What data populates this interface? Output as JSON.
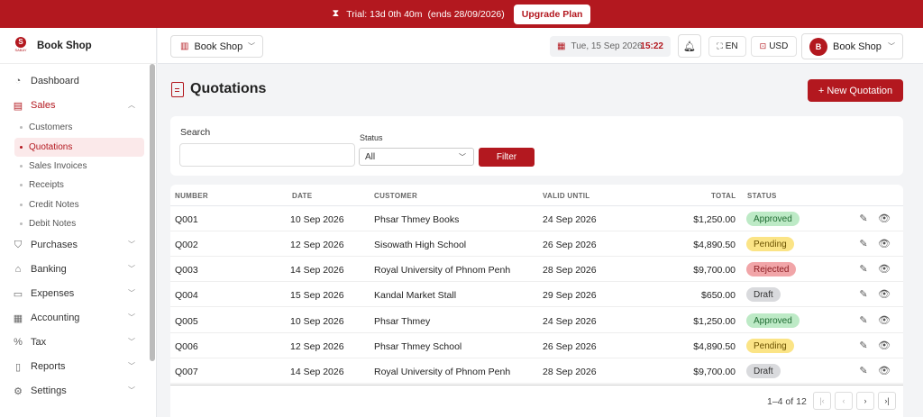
{
  "banner": {
    "trial_text": "Trial: 13d 0th 40m",
    "ends_text": "(ends 28/09/2026)",
    "upgrade_label": "Upgrade Plan",
    "bg_color": "#b3181f"
  },
  "brand": {
    "name": "Book Shop",
    "logo_text": "SABAY"
  },
  "sidebar": {
    "items": [
      {
        "label": "Dashboard",
        "icon": "dashboard-icon"
      },
      {
        "label": "Sales",
        "icon": "receipt-icon",
        "expanded": true
      },
      {
        "label": "Purchases",
        "icon": "bag-icon"
      },
      {
        "label": "Banking",
        "icon": "bank-icon"
      },
      {
        "label": "Expenses",
        "icon": "wallet-icon"
      },
      {
        "label": "Accounting",
        "icon": "ledger-icon"
      },
      {
        "label": "Tax",
        "icon": "percent-icon"
      },
      {
        "label": "Reports",
        "icon": "report-icon"
      },
      {
        "label": "Settings",
        "icon": "gear-icon"
      }
    ],
    "sales_sub": [
      {
        "label": "Customers"
      },
      {
        "label": "Quotations",
        "active": true
      },
      {
        "label": "Sales Invoices"
      },
      {
        "label": "Receipts"
      },
      {
        "label": "Credit Notes"
      },
      {
        "label": "Debit Notes"
      }
    ]
  },
  "topbar": {
    "shop_select": "Book Shop",
    "date": "Tue, 15 Sep 2026",
    "time": "15:22",
    "language": "EN",
    "currency": "USD",
    "user_initial": "B",
    "user_name": "Book Shop"
  },
  "page": {
    "title": "Quotations",
    "new_button": "+ New Quotation"
  },
  "filter": {
    "search_label": "Search",
    "search_value": "",
    "status_label": "Status",
    "status_value": "All",
    "filter_button": "Filter"
  },
  "table": {
    "headers": {
      "number": "NUMBER",
      "date": "DATE",
      "customer": "CUSTOMER",
      "valid_until": "VALID UNTIL",
      "total": "TOTAL",
      "status": "STATUS"
    },
    "rows": [
      {
        "number": "Q001",
        "date": "10 Sep 2026",
        "customer": "Phsar Thmey Books",
        "valid_until": "24 Sep 2026",
        "total": "$1,250.00",
        "status": "Approved"
      },
      {
        "number": "Q002",
        "date": "12 Sep 2026",
        "customer": "Sisowath High School",
        "valid_until": "26 Sep 2026",
        "total": "$4,890.50",
        "status": "Pending"
      },
      {
        "number": "Q003",
        "date": "14 Sep 2026",
        "customer": "Royal University of Phnom Penh",
        "valid_until": "28 Sep 2026",
        "total": "$9,700.00",
        "status": "Rejected"
      },
      {
        "number": "Q004",
        "date": "15 Sep 2026",
        "customer": "Kandal Market Stall",
        "valid_until": "29 Sep 2026",
        "total": "$650.00",
        "status": "Draft"
      },
      {
        "number": "Q005",
        "date": "10 Sep 2026",
        "customer": "Phsar Thmey",
        "valid_until": "24 Sep 2026",
        "total": "$1,250.00",
        "status": "Approved"
      },
      {
        "number": "Q006",
        "date": "12 Sep 2026",
        "customer": "Phsar Thmey School",
        "valid_until": "26 Sep 2026",
        "total": "$4,890.50",
        "status": "Pending"
      },
      {
        "number": "Q007",
        "date": "14 Sep 2026",
        "customer": "Royal University of Phnom Penh",
        "valid_until": "28 Sep 2026",
        "total": "$9,700.00",
        "status": "Draft"
      }
    ],
    "pagination": "1–4 of 12"
  }
}
